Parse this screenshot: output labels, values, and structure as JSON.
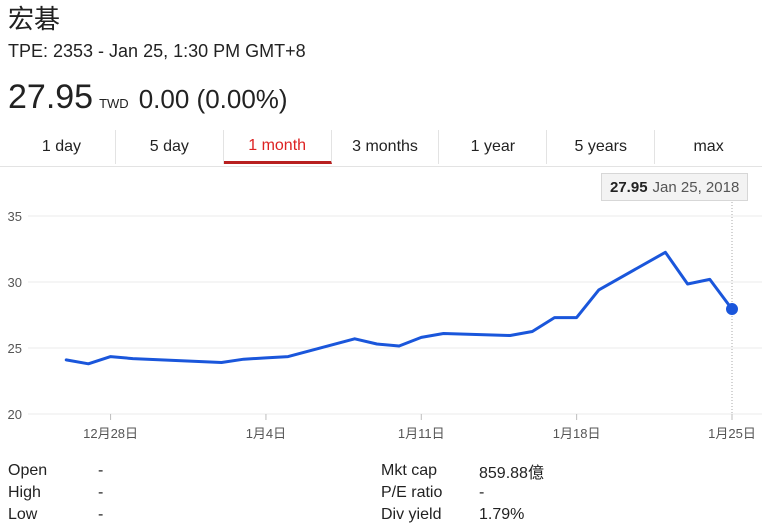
{
  "header": {
    "name": "宏碁",
    "subtitle": "TPE: 2353 - Jan 25, 1:30 PM GMT+8",
    "price": "27.95",
    "currency": "TWD",
    "change": "0.00 (0.00%)"
  },
  "tabs": [
    {
      "label": "1 day",
      "active": false
    },
    {
      "label": "5 day",
      "active": false
    },
    {
      "label": "1 month",
      "active": true
    },
    {
      "label": "3 months",
      "active": false
    },
    {
      "label": "1 year",
      "active": false
    },
    {
      "label": "5 years",
      "active": false
    },
    {
      "label": "max",
      "active": false
    }
  ],
  "tooltip": {
    "value": "27.95",
    "date": "Jan 25, 2018"
  },
  "stats_left": [
    {
      "label": "Open",
      "value": "-"
    },
    {
      "label": "High",
      "value": "-"
    },
    {
      "label": "Low",
      "value": "-"
    }
  ],
  "stats_right": [
    {
      "label": "Mkt cap",
      "value": "859.88億"
    },
    {
      "label": "P/E ratio",
      "value": "-"
    },
    {
      "label": "Div yield",
      "value": "1.79%"
    }
  ],
  "colors": {
    "line": "#1a56db",
    "active_tab": "#dd2222",
    "grid": "#ebebeb"
  },
  "chart_data": {
    "type": "line",
    "x": [
      "2017-12-25",
      "2017-12-26",
      "2017-12-27",
      "2017-12-28",
      "2017-12-29",
      "2018-01-02",
      "2018-01-03",
      "2018-01-04",
      "2018-01-05",
      "2018-01-08",
      "2018-01-09",
      "2018-01-10",
      "2018-01-11",
      "2018-01-12",
      "2018-01-15",
      "2018-01-16",
      "2018-01-17",
      "2018-01-18",
      "2018-01-19",
      "2018-01-22",
      "2018-01-23",
      "2018-01-24",
      "2018-01-25"
    ],
    "values": [
      24.1,
      23.8,
      24.35,
      24.2,
      23.9,
      24.15,
      24.25,
      24.35,
      25.7,
      25.3,
      25.15,
      25.8,
      26.1,
      25.95,
      26.25,
      27.3,
      27.3,
      29.4,
      32.25,
      29.85,
      30.2,
      27.95
    ],
    "x_tick_labels": [
      "12月28日",
      "1月4日",
      "1月11日",
      "1月18日",
      "1月25日"
    ],
    "y_ticks": [
      20,
      25,
      30,
      35
    ],
    "ylim": [
      20,
      35
    ],
    "grid": true,
    "highlight": {
      "x": "2018-01-25",
      "value": 27.95
    }
  }
}
